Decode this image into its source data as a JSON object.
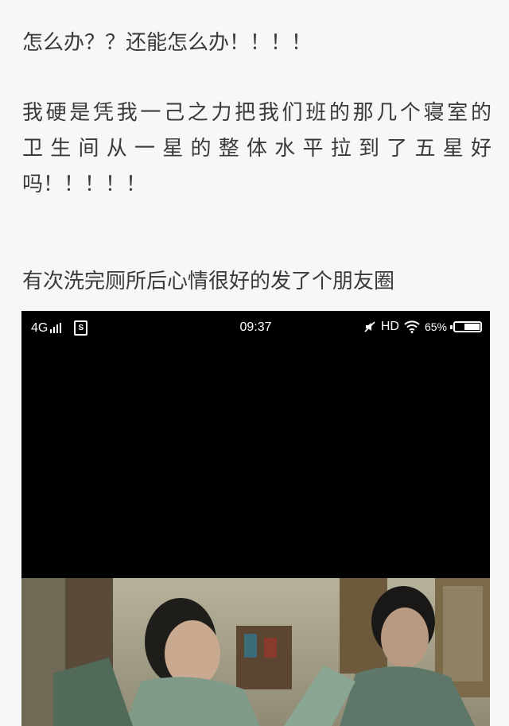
{
  "post": {
    "line1": "怎么办？？还能怎么办！！！！",
    "para2_line1": "我硬是凭我一己之力把我们班的那几个寝室的",
    "para2_line2": "卫生间从一星的整体水平拉到了五星好",
    "para2_line3": "吗！！！！！",
    "line3": "有次洗完厕所后心情很好的发了个朋友圈"
  },
  "status_bar": {
    "network": "4G",
    "time": "09:37",
    "hd": "HD",
    "battery_percent_label": "65%",
    "battery_level": 0.65,
    "icons": [
      "signal-icon",
      "sim-icon",
      "mute-icon",
      "wifi-icon",
      "battery-icon"
    ]
  },
  "video": {
    "description_icon": "video-still-image"
  }
}
